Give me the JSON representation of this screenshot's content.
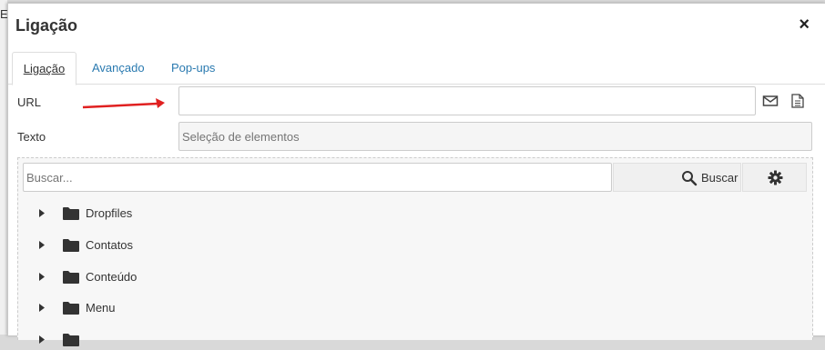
{
  "dialog": {
    "title": "Ligação",
    "close_symbol": "×"
  },
  "tabs": [
    {
      "label": "Ligação",
      "active": true
    },
    {
      "label": "Avançado",
      "active": false
    },
    {
      "label": "Pop-ups",
      "active": false
    }
  ],
  "form": {
    "url_label": "URL",
    "url_value": "",
    "text_label": "Texto",
    "text_placeholder": "Seleção de elementos"
  },
  "browser": {
    "search_placeholder": "Buscar...",
    "search_button_label": "Buscar",
    "items": [
      {
        "label": "Dropfiles"
      },
      {
        "label": "Contatos"
      },
      {
        "label": "Conteúdo"
      },
      {
        "label": "Menu"
      }
    ]
  },
  "colors": {
    "accent_link": "#2a7ab0",
    "annotation_arrow": "#e02020"
  }
}
